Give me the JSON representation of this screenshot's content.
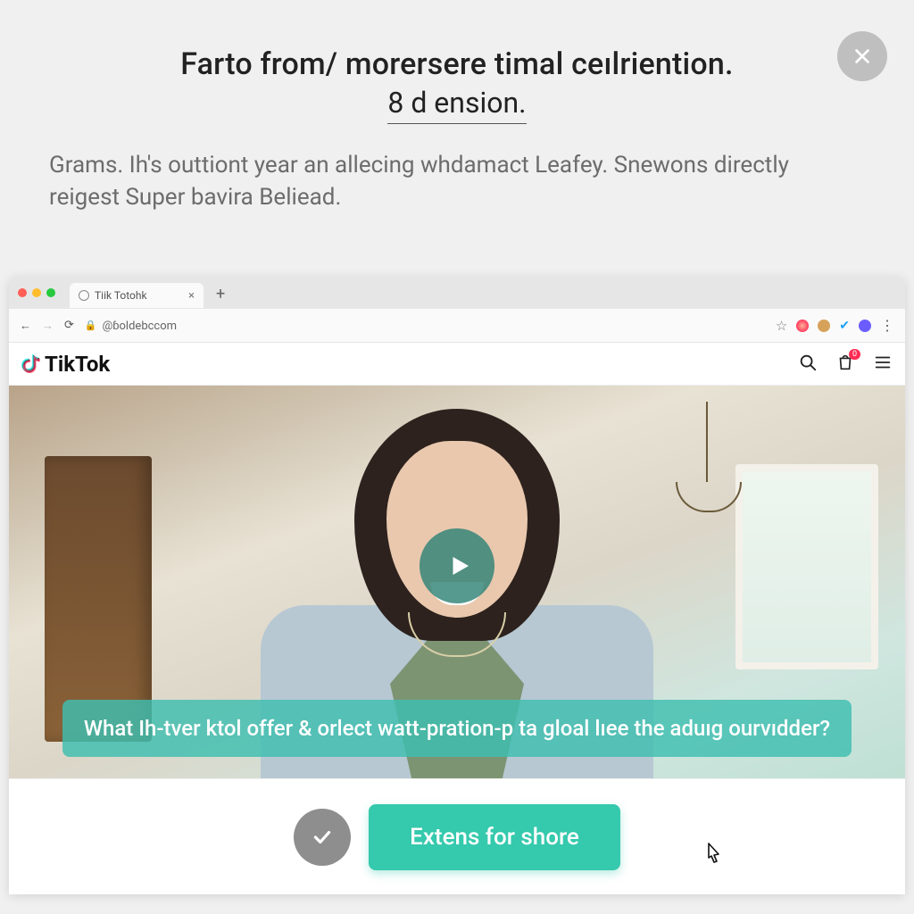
{
  "modal": {
    "title": "Farto from/ morersere timal ceılrientіon.",
    "subtitle": "8 d ensіon.",
    "description": "Grams. Ih's outtiont year an allecing whdamact Leafey. Snewons directly reigest Super bavira Beliead."
  },
  "browser": {
    "tab_title": "Tіik Totohk",
    "url": "@ɓoldebccom",
    "new_tab_label": "+",
    "tab_close_label": "×",
    "star_label": "☆",
    "kebab_label": "⋮"
  },
  "site": {
    "brand": "TikTok",
    "bag_badge": "0"
  },
  "video": {
    "caption": "What Ih-tver ktol offer & orlect watt-pration-p ta gloal lıee the aduıg ourvıdder?"
  },
  "footer": {
    "cta": "Extens for shore"
  },
  "colors": {
    "accent": "#35c9ad",
    "close_bg": "#bfbfbf",
    "badge": "#ff2d55"
  }
}
